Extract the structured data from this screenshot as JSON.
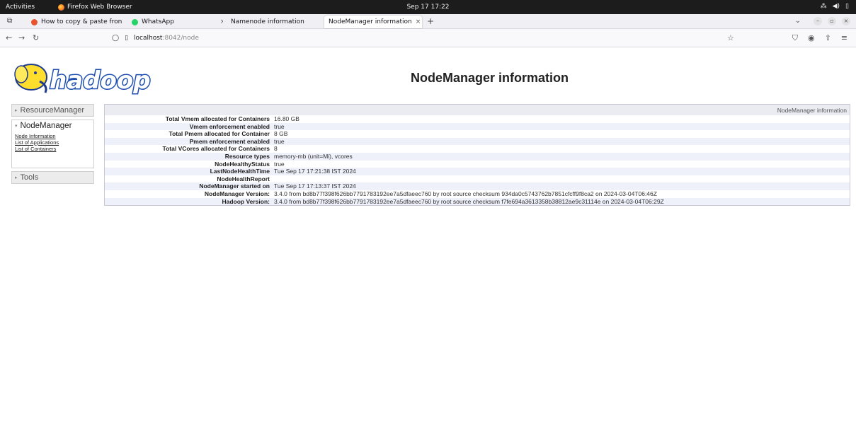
{
  "topbar": {
    "activities": "Activities",
    "app_name": "Firefox Web Browser",
    "clock": "Sep 17  17:22"
  },
  "tabs": [
    {
      "label": "How to copy & paste fron",
      "favicon_color": "#e8542e"
    },
    {
      "label": "WhatsApp",
      "favicon_color": "#25d366"
    },
    {
      "label": "Namenode information",
      "favicon_color": ""
    },
    {
      "label": "NodeManager information",
      "favicon_color": ""
    }
  ],
  "navbar": {
    "url_host": "localhost",
    "url_rest": ":8042/node"
  },
  "page": {
    "logo_text": "hadoop",
    "title": "NodeManager information"
  },
  "sidebar": {
    "resource_manager": "ResourceManager",
    "node_manager": "NodeManager",
    "links": [
      "Node Information",
      "List of Applications",
      "List of Containers"
    ],
    "tools": "Tools"
  },
  "info": {
    "header": "NodeManager information",
    "rows": [
      {
        "key": "Total Vmem allocated for Containers",
        "value": "16.80 GB"
      },
      {
        "key": "Vmem enforcement enabled",
        "value": "true"
      },
      {
        "key": "Total Pmem allocated for Container",
        "value": "8 GB"
      },
      {
        "key": "Pmem enforcement enabled",
        "value": "true"
      },
      {
        "key": "Total VCores allocated for Containers",
        "value": "8"
      },
      {
        "key": "Resource types",
        "value": "memory-mb (unit=Mi), vcores"
      },
      {
        "key": "NodeHealthyStatus",
        "value": "true"
      },
      {
        "key": "LastNodeHealthTime",
        "value": "Tue Sep 17 17:21:38 IST 2024"
      },
      {
        "key": "NodeHealthReport",
        "value": ""
      },
      {
        "key": "NodeManager started on",
        "value": "Tue Sep 17 17:13:37 IST 2024"
      },
      {
        "key": "NodeManager Version:",
        "value": "3.4.0 from bd8b77f398f626bb7791783192ee7a5dfaeec760 by root source checksum 934da0c5743762b7851cfcff9f8ca2 on 2024-03-04T06:46Z"
      },
      {
        "key": "Hadoop Version:",
        "value": "3.4.0 from bd8b77f398f626bb7791783192ee7a5dfaeec760 by root source checksum f7fe694a3613358b38812ae9c31114e on 2024-03-04T06:29Z"
      }
    ]
  }
}
